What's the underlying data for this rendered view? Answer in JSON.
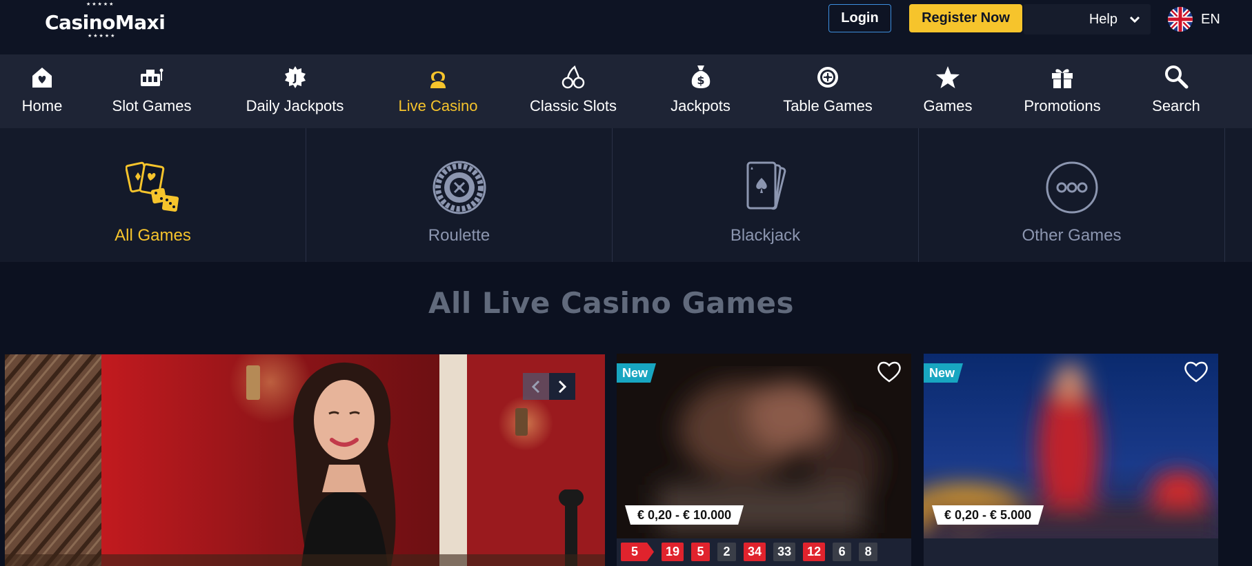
{
  "header": {
    "brand": "CasinoMaxi",
    "login_label": "Login",
    "register_label": "Register Now",
    "help_label": "Help",
    "language": "EN"
  },
  "nav": {
    "items": [
      {
        "label": "Home",
        "icon": "home-heart-icon"
      },
      {
        "label": "Slot Games",
        "icon": "slot-machine-icon"
      },
      {
        "label": "Daily Jackpots",
        "icon": "jackpot-badge-icon"
      },
      {
        "label": "Live Casino",
        "icon": "dealer-icon",
        "active": true
      },
      {
        "label": "Classic Slots",
        "icon": "cherries-icon"
      },
      {
        "label": "Jackpots",
        "icon": "money-bag-icon"
      },
      {
        "label": "Table Games",
        "icon": "roulette-wheel-icon"
      },
      {
        "label": "Games",
        "icon": "star-icon"
      },
      {
        "label": "Promotions",
        "icon": "gift-icon"
      },
      {
        "label": "Search",
        "icon": "search-icon"
      }
    ]
  },
  "categories": [
    {
      "label": "All Games",
      "icon": "cards-dice-icon",
      "active": true
    },
    {
      "label": "Roulette",
      "icon": "roulette-icon"
    },
    {
      "label": "Blackjack",
      "icon": "playing-cards-icon"
    },
    {
      "label": "Other Games",
      "icon": "more-dots-icon"
    }
  ],
  "section_title": "All Live Casino Games",
  "cards": [
    {
      "badge": "New",
      "limits": "€ 0,20 - € 10.000",
      "results": [
        {
          "n": "5",
          "color": "red"
        },
        {
          "n": "19",
          "color": "red"
        },
        {
          "n": "5",
          "color": "red"
        },
        {
          "n": "2",
          "color": "black"
        },
        {
          "n": "34",
          "color": "red"
        },
        {
          "n": "33",
          "color": "black"
        },
        {
          "n": "12",
          "color": "red"
        },
        {
          "n": "6",
          "color": "black"
        },
        {
          "n": "8",
          "color": "black"
        }
      ]
    },
    {
      "badge": "New",
      "limits": "€ 0,20 - € 5.000"
    }
  ],
  "colors": {
    "accent": "#f6c42c",
    "badge": "#18a6c1",
    "result_red": "#e0232d",
    "result_black": "#3a3e48"
  }
}
